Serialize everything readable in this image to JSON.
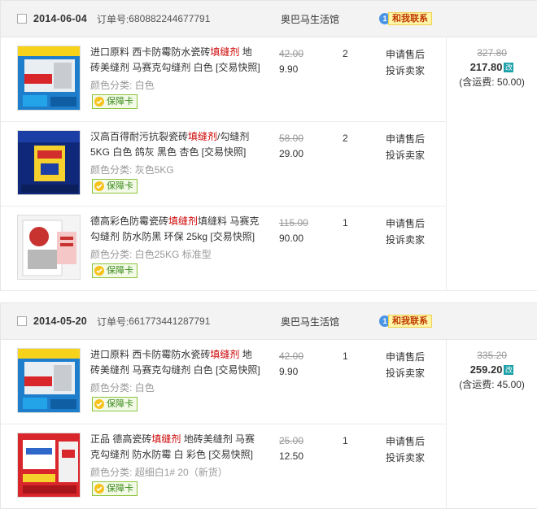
{
  "common": {
    "order_no_label": "订单号:",
    "apply_after_sale": "申请售后",
    "complain_seller": "投诉卖家",
    "contact_label": "和我联系",
    "contact_icon_text": "1",
    "spec_prefix": "颜色分类:",
    "badge_label": "保障卡",
    "modified_label": "改"
  },
  "orders": [
    {
      "date": "2014-06-04",
      "order_no": "680882244677791",
      "shop": "奥巴马生活馆",
      "total": {
        "original": "327.80",
        "paid": "217.80",
        "shipping": "(含运费: 50.00)"
      },
      "items": [
        {
          "title_before": "进口原料 西卡防霉防水瓷砖",
          "title_keyword": "填缝剂",
          "title_after": " 地砖美缝剂 马赛克勾缝剂 白色 [交易快照]",
          "spec": "白色",
          "price_original": "42.00",
          "price_now": "9.90",
          "qty": "2"
        },
        {
          "title_before": "汉高百得耐污抗裂瓷砖",
          "title_keyword": "填缝剂",
          "title_after": "/勾缝剂 5KG 白色 鸽灰 黑色 杏色 [交易快照]",
          "spec": "灰色5KG",
          "price_original": "58.00",
          "price_now": "29.00",
          "qty": "2"
        },
        {
          "title_before": "德高彩色防霉瓷砖",
          "title_keyword": "填缝剂",
          "title_after": "填缝料 马赛克勾缝剂 防水防黑 环保 25kg [交易快照]",
          "spec": "白色25KG 标准型",
          "price_original": "115.00",
          "price_now": "90.00",
          "qty": "1"
        }
      ]
    },
    {
      "date": "2014-05-20",
      "order_no": "661773441287791",
      "shop": "奥巴马生活馆",
      "total": {
        "original": "335.20",
        "paid": "259.20",
        "shipping": "(含运费: 45.00)"
      },
      "items": [
        {
          "title_before": "进口原料 西卡防霉防水瓷砖",
          "title_keyword": "填缝剂",
          "title_after": " 地砖美缝剂 马赛克勾缝剂 白色 [交易快照]",
          "spec": "白色",
          "price_original": "42.00",
          "price_now": "9.90",
          "qty": "1"
        },
        {
          "title_before": "正品 德高瓷砖",
          "title_keyword": "填缝剂",
          "title_after": " 地砖美缝剂 马赛克勾缝剂 防水防霉 白 彩色 [交易快照]",
          "spec": "超细白1# 20（新货）",
          "price_original": "25.00",
          "price_now": "12.50",
          "qty": "1"
        }
      ]
    }
  ]
}
